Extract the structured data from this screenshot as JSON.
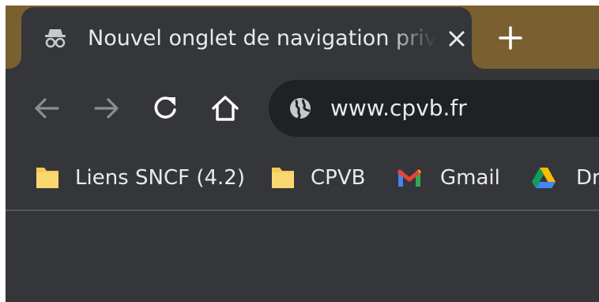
{
  "tab": {
    "icon": "incognito-icon",
    "title": "Nouvel onglet de navigation privée",
    "close_icon": "close-icon"
  },
  "new_tab_icon": "plus-icon",
  "toolbar": {
    "back_icon": "arrow-left-icon",
    "forward_icon": "arrow-right-icon",
    "reload_icon": "reload-icon",
    "home_icon": "home-icon"
  },
  "omnibox": {
    "site_icon": "globe-icon",
    "url": "www.cpvb.fr"
  },
  "bookmarks": [
    {
      "icon": "folder-icon",
      "label": "Liens SNCF (4.2)"
    },
    {
      "icon": "folder-icon",
      "label": "CPVB"
    },
    {
      "icon": "gmail-icon",
      "label": "Gmail"
    },
    {
      "icon": "google-drive-icon",
      "label": "Dr"
    }
  ],
  "colors": {
    "frame": "#7a6031",
    "toolbar": "#35363a",
    "omnibox": "#202124",
    "text": "#e8eaed",
    "folder": "#f7cb4d",
    "disabled_icon": "#8a8d91"
  }
}
